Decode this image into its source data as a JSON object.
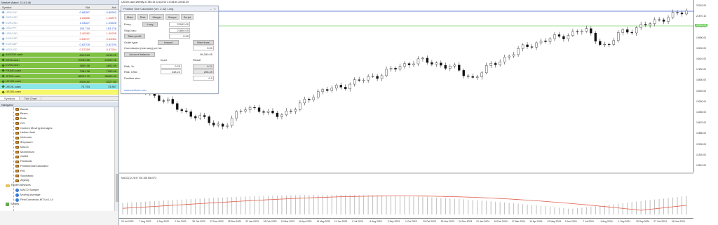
{
  "market_watch": {
    "title": "Market Watch: 11:41:46",
    "col_symbol": "Symbol",
    "col_bid": "Bid",
    "col_ask": "Ask",
    "rows": [
      {
        "symbol": "USDCHF",
        "bid": "0.88387",
        "ask": "0.88393",
        "color": "#2a5bd7",
        "bg": "#ffffff",
        "dim": true
      },
      {
        "symbol": "GBPUSD",
        "bid": "1.26866",
        "ask": "1.26879",
        "color": "#d23b2a",
        "bg": "#ffffff",
        "dim": true
      },
      {
        "symbol": "EURUSD",
        "bid": "1.04627",
        "ask": "1.04628",
        "color": "#2a5bd7",
        "bg": "#ffffff",
        "dim": true
      },
      {
        "symbol": "USDJPY",
        "bid": "153.718",
        "ask": "153.728",
        "color": "#2a5bd7",
        "bg": "#ffffff",
        "dim": true
      },
      {
        "symbol": "USDCAD",
        "bid": "1.40282",
        "ask": "1.40295",
        "color": "#d23b2a",
        "bg": "#ffffff",
        "dim": true
      },
      {
        "symbol": "AUDUSD",
        "bid": "0.63077",
        "ask": "0.63083",
        "color": "#d23b2a",
        "bg": "#ffffff",
        "dim": true
      },
      {
        "symbol": "EURGBP",
        "bid": "0.82709",
        "ask": "0.82709",
        "color": "#2a5bd7",
        "bg": "#ffffff",
        "dim": true
      },
      {
        "symbol": "NZDUSD",
        "bid": "0.57259",
        "ask": "0.57264",
        "color": "#d23b2a",
        "bg": "#ffffff",
        "dim": true
      },
      {
        "symbol": "AUS200.cash",
        "bid": "8313.83",
        "ask": "8315.20",
        "color": "#1a1a1a",
        "bg": "#7fc241",
        "dim": false
      },
      {
        "symbol": "DE30.cash",
        "bid": "20259.88",
        "ask": "20260.98",
        "color": "#1a1a1a",
        "bg": "#7fc241",
        "dim": false
      },
      {
        "symbol": "EU50.cash",
        "bid": "4850.48",
        "ask": "4852.08",
        "color": "#1a1a1a",
        "bg": "#7fc241",
        "dim": false
      },
      {
        "symbol": "FRA40.cash",
        "bid": "7381.38",
        "ask": "7383.08",
        "color": "#1a1a1a",
        "bg": "#7fc241",
        "dim": false
      },
      {
        "symbol": "JP225.cash",
        "bid": "38251.70",
        "ask": "38263.30",
        "color": "#1a1a1a",
        "bg": "#7fc241",
        "dim": false
      },
      {
        "symbol": "UK100.cash",
        "bid": "8326.80",
        "ask": "8327.80",
        "color": "#1a1a1a",
        "bg": "#7fc241",
        "dim": false
      },
      {
        "symbol": "UKOIL.cash",
        "bid": "73.754",
        "ask": "73.807",
        "color": "#1a1a1a",
        "bg": "#8be8e8",
        "dim": false
      },
      {
        "symbol": "US100.cash",
        "bid": "",
        "ask": "",
        "color": "#1a1a1a",
        "bg": "#f7f76a",
        "dim": false
      }
    ],
    "tabs": [
      "Symbols",
      "Tick Chart"
    ]
  },
  "navigator": {
    "title": "Navigator",
    "indicators": [
      "Bands",
      "Bears",
      "Bulls",
      "CCI",
      "Custom Moving Averages",
      "Heiken Ashi",
      "Ichimoku",
      "iExposure",
      "MACD",
      "Momentum",
      "OsMA",
      "Parabolic",
      "PositionSizeCalculator",
      "RSI",
      "Stochastic",
      "ZigZag"
    ],
    "experts_folder": "Expert Advisors",
    "experts": [
      "MACD Sample",
      "Moving Average",
      "PineConnector-MT4-v1.14"
    ],
    "scripts_folder": "Scripts"
  },
  "chart": {
    "title": "US100.cash,Weekly  21785.15 22132.00 21748.60 22042.00",
    "indicator_label": "MACD(12,26,9) 706.188 636.573",
    "price_ticks": [
      "22042.00",
      "21570.10",
      "20780.00",
      "19990.00",
      "19200.00",
      "18410.00",
      "17620.00",
      "16830.00",
      "16040.00",
      "15250.00",
      "14460.00",
      "13670.00",
      "12880.00",
      "12090.00",
      "11300.00",
      "10510.00"
    ],
    "current_price_label": "22042.00",
    "green_line_label": "21180.00",
    "time_ticks": [
      "24 Jul 2022",
      "7 Aug 2022",
      "4 Sep 2022",
      "2 Oct 2022",
      "30 Oct 2022",
      "27 Nov 2022",
      "25 Dec 2022",
      "22 Jan 2023",
      "19 Feb 2023",
      "19 Mar 2023",
      "16 Apr 2023",
      "14 May 2023",
      "11 Jun 2023",
      "9 Jul 2023",
      "6 Aug 2023",
      "3 Sep 2023",
      "1 Oct 2023",
      "29 Oct 2023",
      "26 Nov 2023",
      "24 Dec 2023",
      "21 Jan 2024",
      "18 Feb 2024",
      "17 Mar 2024",
      "14 Apr 2024",
      "12 May 2024",
      "9 Jun 2024",
      "7 Jul 2024",
      "4 Aug 2024",
      "1 Sep 2024",
      "29 Sep 2024",
      "27 Oct 2024",
      "24 Nov 2024"
    ],
    "colors": {
      "blue_line": "#3b5cd6",
      "green_line": "#7ed36a",
      "macd_line": "#e0604c",
      "bars": "#bdbdbd"
    }
  },
  "psc": {
    "title": "Position Size Calculator (ver. 2.42) Long",
    "tabs": [
      "Main",
      "Risk",
      "Margin",
      "Swaps",
      "Script"
    ],
    "entry_label": "Entry:",
    "entry_button": "Long",
    "entry_value": "22042.00",
    "stop_label": "Stop-loss:",
    "stop_value": "21800.00",
    "tp_button": "Take-profit:",
    "tp_value": "0.00",
    "order_label": "Order type:",
    "order_button": "Instant",
    "hide_lines_button": "Hide lines",
    "commission_label": "Commission (one-way) per lot:",
    "commission_value": "0.00",
    "account_button": "Account balance",
    "account_value": "99,290.05",
    "input_header": "Input",
    "result_header": "Result",
    "risk_pct_label": "Risk, %:",
    "risk_pct_input": "0.25",
    "risk_pct_result": "0.21",
    "risk_usd_label": "Risk, USD:",
    "risk_usd_input": "248.22",
    "risk_usd_result": "208.49",
    "pos_size_label": "Position size:",
    "pos_size_value": "0.2",
    "link": "www.earnforex.com"
  }
}
